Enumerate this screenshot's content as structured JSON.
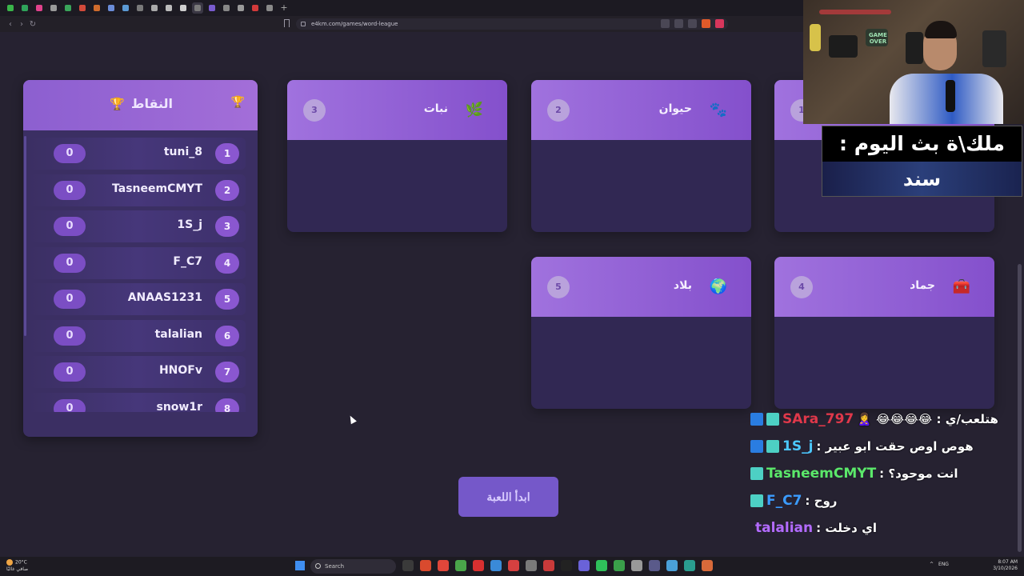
{
  "browser": {
    "url": "e4km.com/games/word-league",
    "tab_colors": [
      "#3ab54a",
      "#2fa35a",
      "#e0428c",
      "#9a9a9a",
      "#3aa55a",
      "#d24a3a",
      "#cf6b2c",
      "#6a8cd8",
      "#5b9ad4",
      "#7a7a7a",
      "#aaaaaa",
      "#bbbbbb",
      "#cfcfcf",
      "#7a7a7a",
      "#7a5ccf",
      "#888888",
      "#9a9a9a",
      "#d23a3a",
      "#8a8a8a"
    ],
    "new_tab": "+"
  },
  "scores": {
    "title": "النقاط",
    "trophy_icon": "🏆",
    "players": [
      {
        "rank": "1",
        "name": "tuni_8",
        "score": "0"
      },
      {
        "rank": "2",
        "name": "TasneemCMYT",
        "score": "0"
      },
      {
        "rank": "3",
        "name": "1S_j",
        "score": "0"
      },
      {
        "rank": "4",
        "name": "F_C7",
        "score": "0"
      },
      {
        "rank": "5",
        "name": "ANAAS1231",
        "score": "0"
      },
      {
        "rank": "6",
        "name": "talalian",
        "score": "0"
      },
      {
        "rank": "7",
        "name": "HNOFv",
        "score": "0"
      },
      {
        "rank": "8",
        "name": "snow1r",
        "score": "0"
      }
    ]
  },
  "categories": [
    {
      "title": "نبات",
      "count": "3",
      "icon": "🌿"
    },
    {
      "title": "حيوان",
      "count": "2",
      "icon": "🐾"
    },
    {
      "title": "",
      "count": "1",
      "icon": ""
    },
    {
      "title": "بلاد",
      "count": "5",
      "icon": "🌍"
    },
    {
      "title": "جماد",
      "count": "4",
      "icon": "🧰"
    }
  ],
  "start_button": "ابدأ اللعبة",
  "overlay": {
    "banner_top": "ملك\\ة بث اليوم :",
    "banner_bottom": "سند",
    "poster_text": "GAME\nOVER"
  },
  "chat": [
    {
      "user": "SAra_797",
      "user_color": "#e0384a",
      "message": "هتلعب/ي : 😂😂😂😂 🙎‍♀️",
      "badges": 2
    },
    {
      "user": "1S_j",
      "user_color": "#4cc8ff",
      "message": "هوص اوص حقت ابو عبير :",
      "badges": 2
    },
    {
      "user": "TasneemCMYT",
      "user_color": "#5be86a",
      "message": "انت موحود؟ :",
      "badges": 1
    },
    {
      "user": "F_C7",
      "user_color": "#3b9cff",
      "message": "روح :",
      "badges": 1
    },
    {
      "user": "talalian",
      "user_color": "#b36bff",
      "message": "اي دخلت :",
      "badges": 0
    }
  ],
  "taskbar": {
    "weather_temp": "20°C",
    "weather_desc": "صافي غالبًا",
    "search": "Search",
    "lang": "ENG",
    "time": "8:07 AM",
    "date": "3/10/2026",
    "app_colors": [
      "#3a3a3a",
      "#d94a2e",
      "#e0463a",
      "#4aa64a",
      "#d83030",
      "#3a8ad8",
      "#d64040",
      "#7a7a7a",
      "#c93a3a",
      "#222222",
      "#6a62d8",
      "#2fbf5a",
      "#3aa04a",
      "#999999",
      "#5a5a8a",
      "#4aa0d8",
      "#2a9d8f",
      "#d86a3a"
    ]
  }
}
